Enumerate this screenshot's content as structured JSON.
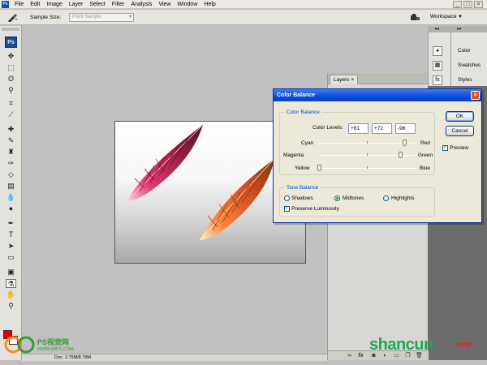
{
  "menubar": {
    "app_icon": "Ps",
    "items": [
      "File",
      "Edit",
      "Image",
      "Layer",
      "Select",
      "Filter",
      "Analysis",
      "View",
      "Window",
      "Help"
    ],
    "window_controls": [
      "_",
      "□",
      "×"
    ]
  },
  "options_bar": {
    "tool_icon": "eyedropper-icon",
    "sample_size_label": "Sample Size:",
    "sample_size_value": "Point Sample",
    "workspace_label": "Workspace"
  },
  "toolbox": {
    "logo": "Ps",
    "tools": [
      "move",
      "marquee",
      "lasso",
      "magic-wand",
      "crop",
      "slice",
      "healing-brush",
      "brush",
      "clone-stamp",
      "history-brush",
      "eraser",
      "gradient",
      "blur",
      "dodge",
      "pen",
      "type",
      "path-selection",
      "shape",
      "notes",
      "eyedropper",
      "hand",
      "zoom"
    ],
    "foreground_color": "#e00000",
    "background_color": "#ffffff"
  },
  "layers_panel": {
    "tab_label": "Layers",
    "tab_close": "×",
    "bottom_icons": [
      "fx",
      "mask",
      "adjustment",
      "group",
      "new-layer",
      "delete"
    ]
  },
  "dock": {
    "panels": [
      {
        "label": "Color",
        "icon": "color-icon"
      },
      {
        "label": "Swatches",
        "icon": "swatches-icon"
      },
      {
        "label": "Styles",
        "icon": "styles-icon"
      }
    ]
  },
  "status_bar": {
    "zoom": "",
    "doc": "Doc: 2.75M/8.79M"
  },
  "dialog": {
    "title": "Color Balance",
    "close": "×",
    "color_balance_group": "Color Balance",
    "color_levels_label": "Color Levels:",
    "levels": [
      "+81",
      "+72",
      "-98"
    ],
    "sliders": [
      {
        "left": "Cyan",
        "right": "Red",
        "value": 81
      },
      {
        "left": "Magenta",
        "right": "Green",
        "value": 72
      },
      {
        "left": "Yellow",
        "right": "Blue",
        "value": -98
      }
    ],
    "tone_balance_group": "Tone Balance",
    "tones": [
      "Shadows",
      "Midtones",
      "Highlights"
    ],
    "selected_tone": "Midtones",
    "preserve_luminosity": "Preserve Luminosity",
    "preserve_checked": true,
    "ok": "OK",
    "cancel": "Cancel",
    "preview": "Preview",
    "preview_checked": true
  },
  "watermarks": {
    "left_text": "PS视觉网",
    "left_url": "WWW.68PS.COM",
    "right_text": "shancun",
    "right_cn": "山村网"
  }
}
